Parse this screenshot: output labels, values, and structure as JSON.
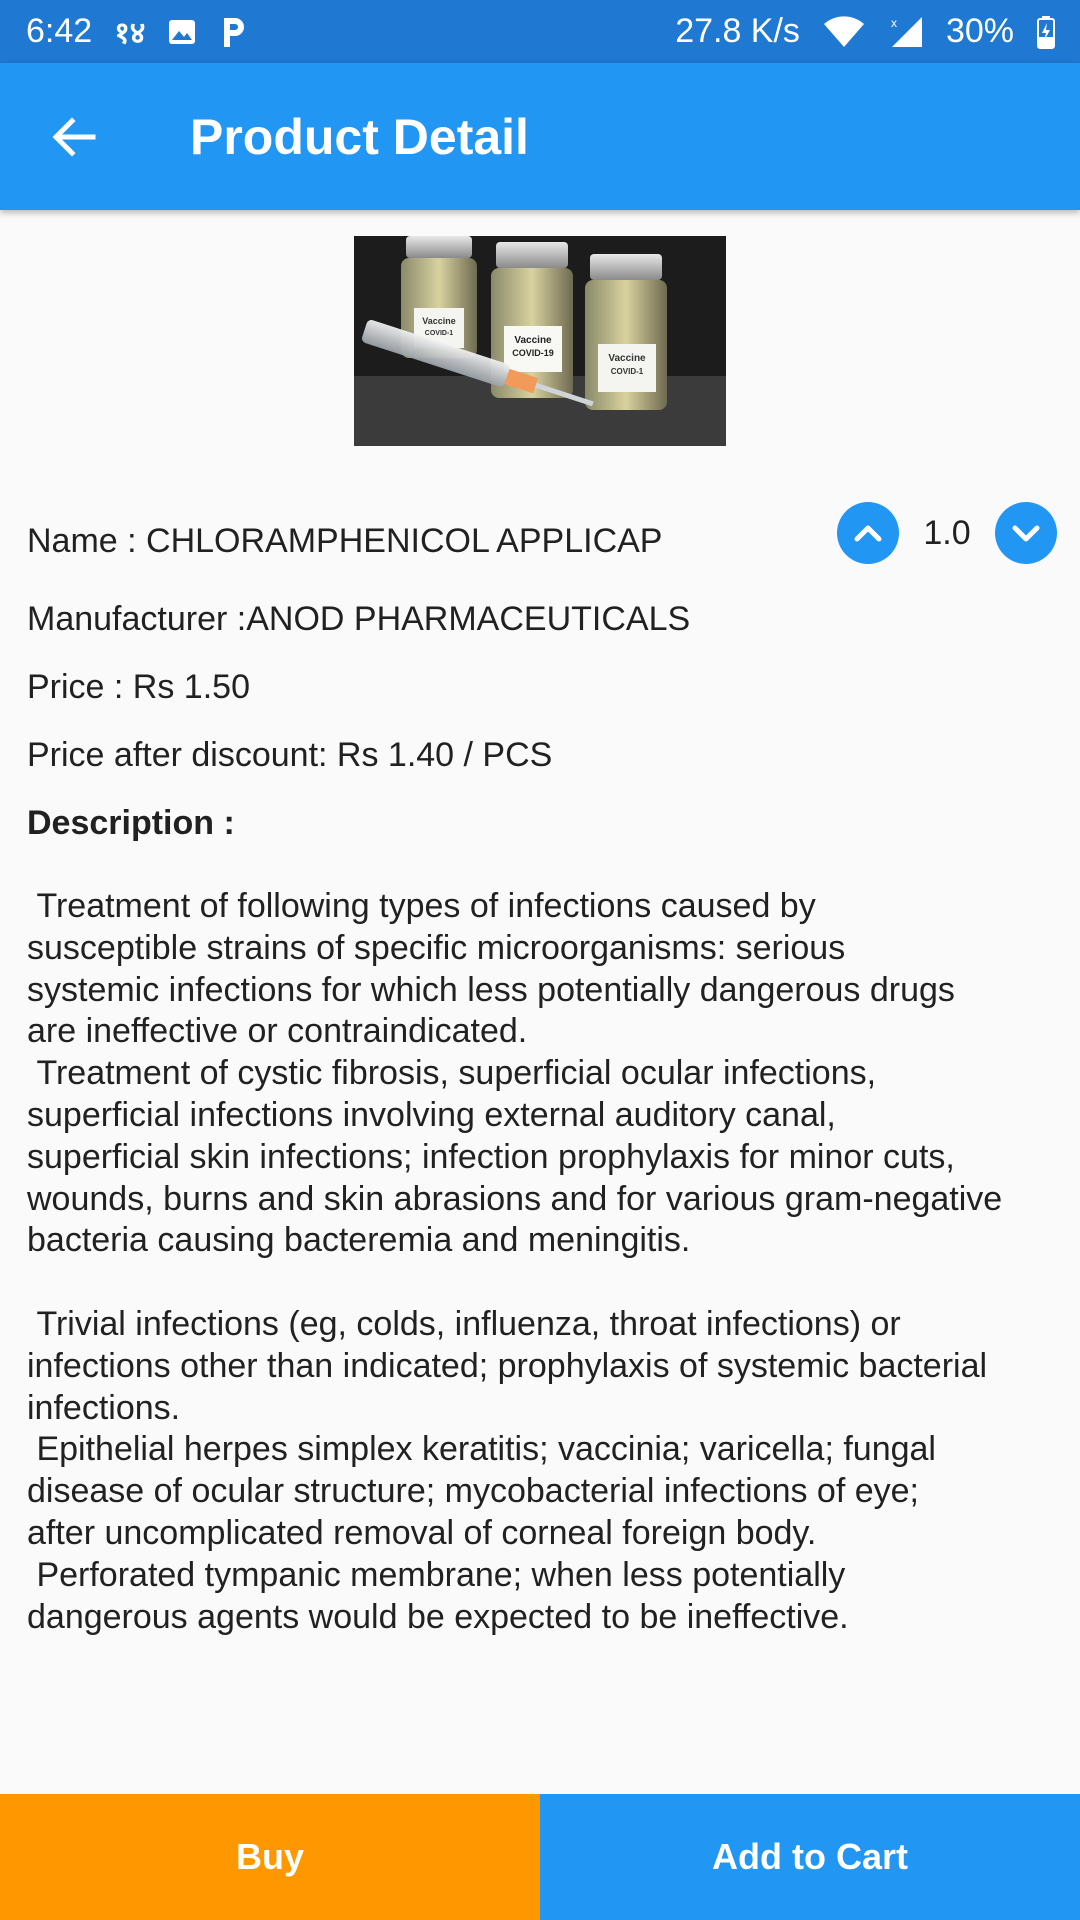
{
  "status_bar": {
    "time": "6:42",
    "notification_text": "१४",
    "speed": "27.8 K/s",
    "battery": "30%",
    "icons": [
      "gallery-icon",
      "p-app-icon",
      "wifi-icon",
      "signal-icon",
      "battery-charging-icon"
    ]
  },
  "app_bar": {
    "title": "Product Detail",
    "back_icon": "arrow-back-icon",
    "color": "#2196f3"
  },
  "product": {
    "name_line": "Name : CHLORAMPHENICOL APPLICAP",
    "manufacturer_line": "Manufacturer :ANOD PHARMACEUTICALS",
    "price_line": "Price : Rs 1.50",
    "discount_line": "Price after discount: Rs 1.40 / PCS",
    "description_heading": "Description :",
    "description": " Treatment of following types of infections caused by\nsusceptible strains of specific microorganisms: serious\nsystemic infections for which less potentially dangerous drugs\nare ineffective or contraindicated.\n Treatment of cystic fibrosis, superficial ocular infections,\nsuperficial infections involving external auditory canal,\nsuperficial skin infections; infection prophylaxis for minor cuts,\nwounds, burns and skin abrasions and for various gram-negative\nbacteria causing bacteremia and meningitis.\n\n Trivial infections (eg, colds, influenza, throat infections) or\ninfections other than indicated; prophylaxis of systemic bacterial\ninfections.\n Epithelial herpes simplex keratitis; vaccinia; varicella; fungal\ndisease of ocular structure; mycobacterial infections of eye;\nafter uncomplicated removal of corneal foreign body.\n Perforated tympanic membrane; when less potentially\ndangerous agents would be expected to be ineffective.",
    "image_labels": {
      "vial_left": "Vaccine\nCOVID-1",
      "vial_center": "Vaccine\nCOVID-19",
      "vial_right": "Vaccine\nCOVID-1"
    }
  },
  "quantity": {
    "value": "1.0",
    "increase_icon": "chevron-up-icon",
    "decrease_icon": "chevron-down-icon"
  },
  "actions": {
    "buy_label": "Buy",
    "cart_label": "Add to Cart",
    "buy_color": "#ff9800",
    "cart_color": "#2196f3"
  }
}
